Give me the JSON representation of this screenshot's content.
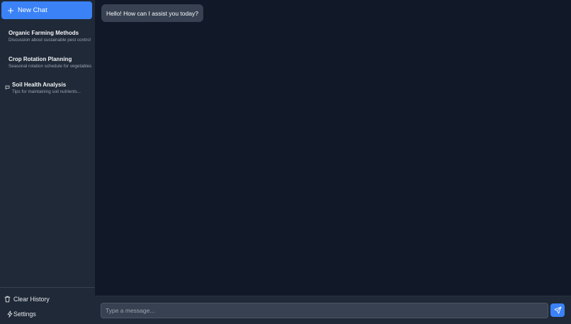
{
  "sidebar": {
    "new_chat_label": "New Chat",
    "chats": [
      {
        "title": "Organic Farming Methods",
        "subtitle": "Discussion about sustainable pest control"
      },
      {
        "title": "Crop Rotation Planning",
        "subtitle": "Seasonal rotation schedule for vegetables"
      },
      {
        "title": "Soil Health Analysis",
        "subtitle": "Tips for maintaining soil nutrients..."
      }
    ],
    "clear_history_label": "Clear History",
    "settings_label": "Settings"
  },
  "chat": {
    "messages": [
      {
        "role": "assistant",
        "text": "Hello! How can I assist you today?"
      }
    ]
  },
  "composer": {
    "placeholder": "Type a message..."
  },
  "colors": {
    "accent": "#3b82f6",
    "sidebar_bg": "#1f2937",
    "main_bg": "#111827",
    "bubble_bg": "#374151"
  }
}
